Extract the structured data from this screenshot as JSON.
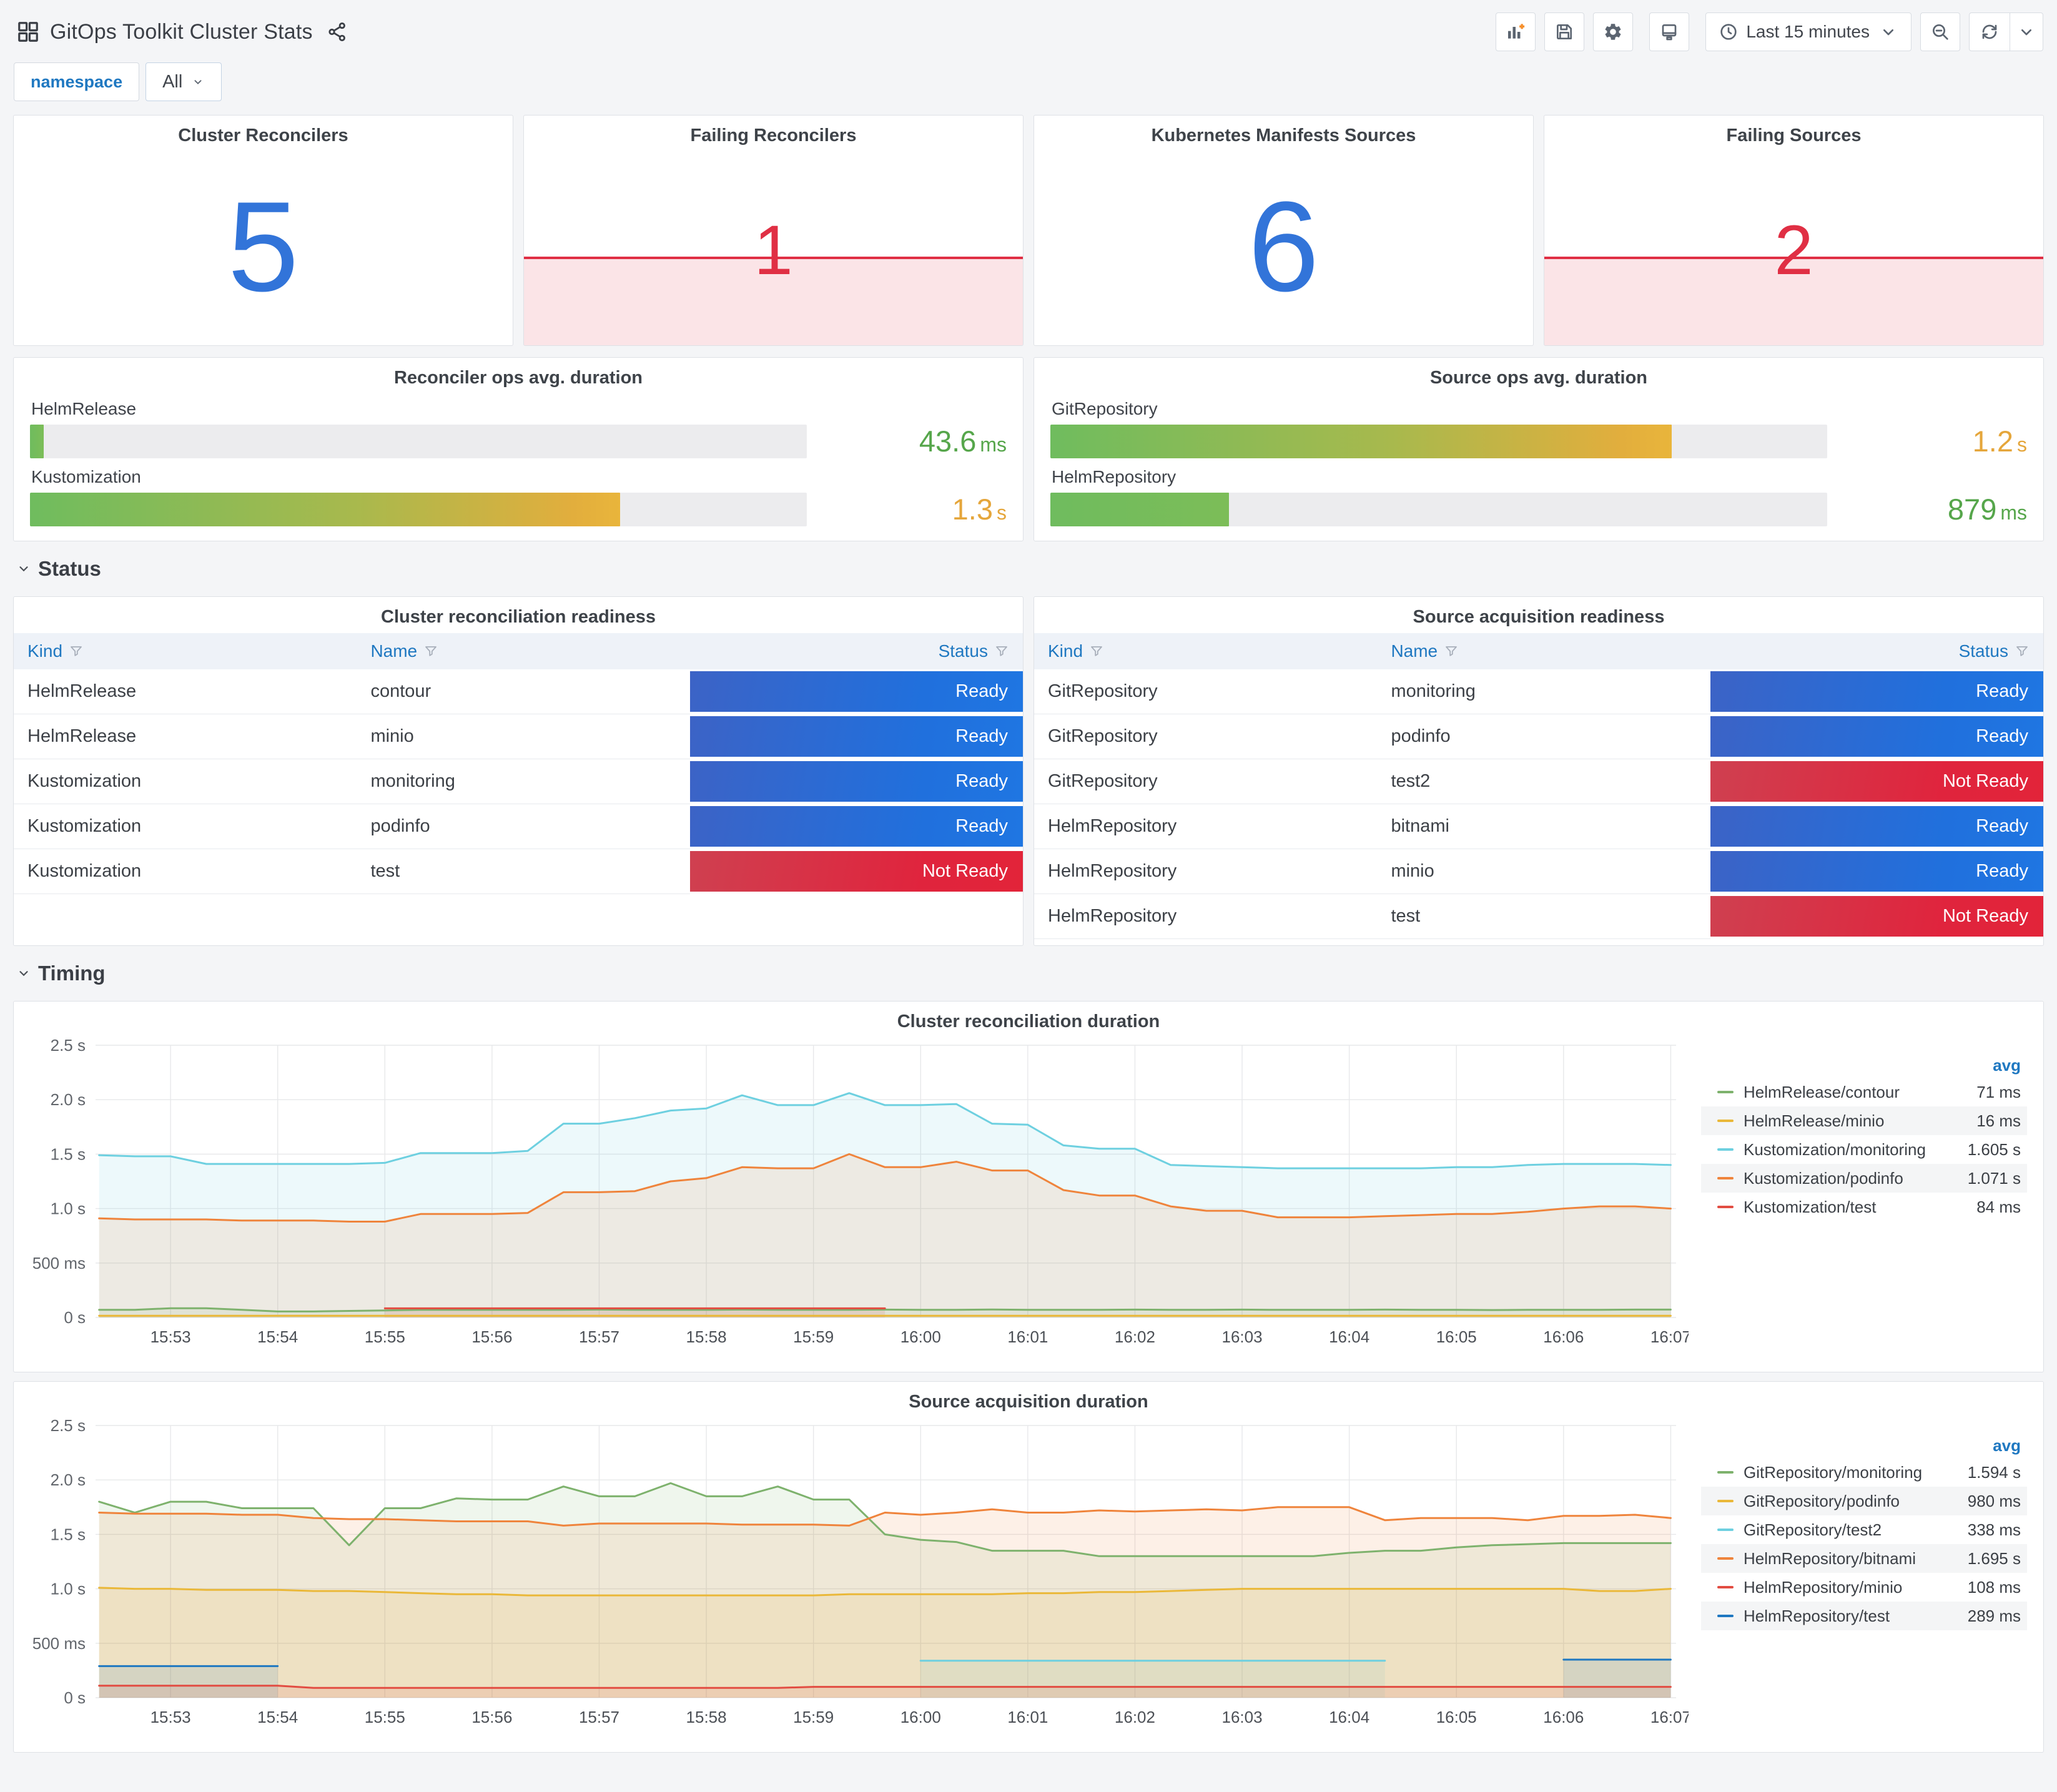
{
  "header": {
    "title": "GitOps Toolkit Cluster Stats"
  },
  "toolbar": {
    "time_range": "Last 15 minutes"
  },
  "filters": {
    "name": "namespace",
    "value": "All"
  },
  "sections": {
    "status": "Status",
    "timing": "Timing"
  },
  "stats": [
    {
      "title": "Cluster Reconcilers",
      "value": "5",
      "state": "ok"
    },
    {
      "title": "Failing Reconcilers",
      "value": "1",
      "state": "alert"
    },
    {
      "title": "Kubernetes Manifests Sources",
      "value": "6",
      "state": "ok"
    },
    {
      "title": "Failing Sources",
      "value": "2",
      "state": "alert"
    }
  ],
  "gauges": [
    {
      "title": "Reconciler ops avg. duration",
      "bars": [
        {
          "label": "HelmRelease",
          "num": "43.6",
          "unit": "ms",
          "pct": 1.8,
          "tone": "green"
        },
        {
          "label": "Kustomization",
          "num": "1.3",
          "unit": "s",
          "pct": 76,
          "tone": "orange"
        }
      ]
    },
    {
      "title": "Source ops avg. duration",
      "bars": [
        {
          "label": "GitRepository",
          "num": "1.2",
          "unit": "s",
          "pct": 80,
          "tone": "orange"
        },
        {
          "label": "HelmRepository",
          "num": "879",
          "unit": "ms",
          "pct": 23,
          "tone": "green"
        }
      ]
    }
  ],
  "tables": [
    {
      "title": "Cluster reconciliation readiness",
      "columns": [
        "Kind",
        "Name",
        "Status"
      ],
      "rows": [
        [
          "HelmRelease",
          "contour",
          "Ready"
        ],
        [
          "HelmRelease",
          "minio",
          "Ready"
        ],
        [
          "Kustomization",
          "monitoring",
          "Ready"
        ],
        [
          "Kustomization",
          "podinfo",
          "Ready"
        ],
        [
          "Kustomization",
          "test",
          "Not Ready"
        ]
      ]
    },
    {
      "title": "Source acquisition readiness",
      "columns": [
        "Kind",
        "Name",
        "Status"
      ],
      "rows": [
        [
          "GitRepository",
          "monitoring",
          "Ready"
        ],
        [
          "GitRepository",
          "podinfo",
          "Ready"
        ],
        [
          "GitRepository",
          "test2",
          "Not Ready"
        ],
        [
          "HelmRepository",
          "bitnami",
          "Ready"
        ],
        [
          "HelmRepository",
          "minio",
          "Ready"
        ],
        [
          "HelmRepository",
          "test",
          "Not Ready"
        ]
      ]
    }
  ],
  "chart_data": [
    {
      "type": "line",
      "title": "Cluster reconciliation duration",
      "legend_header": "avg",
      "ylim": [
        0,
        2.5
      ],
      "y_tick_values": [
        0,
        0.5,
        1.0,
        1.5,
        2.0,
        2.5
      ],
      "y_tick_labels": [
        "0 s",
        "500 ms",
        "1.0 s",
        "1.5 s",
        "2.0 s",
        "2.5 s"
      ],
      "x_domain": [
        52.3,
        67.05
      ],
      "x_start": 52.3333,
      "x_step": 0.33333,
      "x_tick_values": [
        53,
        54,
        55,
        56,
        57,
        58,
        59,
        60,
        61,
        62,
        63,
        64,
        65,
        66,
        67
      ],
      "x_tick_labels": [
        "15:53",
        "15:54",
        "15:55",
        "15:56",
        "15:57",
        "15:58",
        "15:59",
        "16:00",
        "16:01",
        "16:02",
        "16:03",
        "16:04",
        "16:05",
        "16:06",
        "16:07"
      ],
      "series": [
        {
          "name": "HelmRelease/contour",
          "avg": "71 ms",
          "color": "#7EB26D",
          "values": [
            0.07,
            0.07,
            0.085,
            0.085,
            0.07,
            0.055,
            0.055,
            0.06,
            0.065,
            0.07,
            0.07,
            0.07,
            0.07,
            0.07,
            0.072,
            0.07,
            0.07,
            0.07,
            0.072,
            0.07,
            0.07,
            0.07,
            0.072,
            0.07,
            0.07,
            0.073,
            0.07,
            0.07,
            0.07,
            0.072,
            0.07,
            0.07,
            0.072,
            0.07,
            0.07,
            0.07,
            0.072,
            0.07,
            0.07,
            0.068,
            0.07,
            0.07,
            0.07,
            0.072,
            0.072
          ]
        },
        {
          "name": "HelmRelease/minio",
          "avg": "16 ms",
          "color": "#EAB839",
          "values": [
            0.016,
            0.016,
            0.016,
            0.016,
            0.016,
            0.016,
            0.016,
            0.016,
            0.016,
            0.016,
            0.016,
            0.016,
            0.016,
            0.016,
            0.016,
            0.016,
            0.016,
            0.016,
            0.016,
            0.016,
            0.016,
            0.016,
            0.016,
            0.016,
            0.016,
            0.016,
            0.016,
            0.016,
            0.016,
            0.016,
            0.016,
            0.016,
            0.016,
            0.016,
            0.016,
            0.016,
            0.016,
            0.016,
            0.016,
            0.016,
            0.016,
            0.016,
            0.016,
            0.016,
            0.016
          ]
        },
        {
          "name": "Kustomization/monitoring",
          "avg": "1.605 s",
          "color": "#6ED0E0",
          "values": [
            1.49,
            1.48,
            1.48,
            1.41,
            1.41,
            1.41,
            1.41,
            1.41,
            1.42,
            1.51,
            1.51,
            1.51,
            1.53,
            1.78,
            1.78,
            1.83,
            1.9,
            1.92,
            2.04,
            1.95,
            1.95,
            2.06,
            1.95,
            1.95,
            1.96,
            1.78,
            1.77,
            1.58,
            1.55,
            1.55,
            1.4,
            1.39,
            1.38,
            1.37,
            1.37,
            1.37,
            1.37,
            1.37,
            1.38,
            1.38,
            1.4,
            1.41,
            1.41,
            1.41,
            1.4
          ]
        },
        {
          "name": "Kustomization/podinfo",
          "avg": "1.071 s",
          "color": "#EF843C",
          "values": [
            0.91,
            0.9,
            0.9,
            0.9,
            0.89,
            0.89,
            0.89,
            0.88,
            0.88,
            0.95,
            0.95,
            0.95,
            0.96,
            1.15,
            1.15,
            1.16,
            1.25,
            1.28,
            1.38,
            1.37,
            1.37,
            1.5,
            1.38,
            1.38,
            1.43,
            1.35,
            1.35,
            1.17,
            1.12,
            1.12,
            1.02,
            0.98,
            0.98,
            0.92,
            0.92,
            0.92,
            0.93,
            0.94,
            0.95,
            0.95,
            0.97,
            1.0,
            1.02,
            1.02,
            1.0
          ]
        },
        {
          "name": "Kustomization/test",
          "avg": "84 ms",
          "color": "#E24D42",
          "values": [
            null,
            null,
            null,
            null,
            null,
            null,
            null,
            null,
            0.084,
            0.084,
            0.084,
            0.084,
            0.084,
            0.084,
            0.084,
            0.084,
            0.084,
            0.084,
            0.084,
            0.084,
            0.084,
            0.084,
            0.084,
            null,
            null,
            null,
            null,
            null,
            null,
            null,
            null,
            null,
            null,
            null,
            null,
            null,
            null,
            null,
            null,
            null,
            null,
            null,
            null,
            null,
            null
          ]
        }
      ]
    },
    {
      "type": "line",
      "title": "Source acquisition duration",
      "legend_header": "avg",
      "ylim": [
        0,
        2.5
      ],
      "y_tick_values": [
        0,
        0.5,
        1.0,
        1.5,
        2.0,
        2.5
      ],
      "y_tick_labels": [
        "0 s",
        "500 ms",
        "1.0 s",
        "1.5 s",
        "2.0 s",
        "2.5 s"
      ],
      "x_domain": [
        52.3,
        67.05
      ],
      "x_start": 52.3333,
      "x_step": 0.33333,
      "x_tick_values": [
        53,
        54,
        55,
        56,
        57,
        58,
        59,
        60,
        61,
        62,
        63,
        64,
        65,
        66,
        67
      ],
      "x_tick_labels": [
        "15:53",
        "15:54",
        "15:55",
        "15:56",
        "15:57",
        "15:58",
        "15:59",
        "16:00",
        "16:01",
        "16:02",
        "16:03",
        "16:04",
        "16:05",
        "16:06",
        "16:07"
      ],
      "series": [
        {
          "name": "GitRepository/monitoring",
          "avg": "1.594 s",
          "color": "#7EB26D",
          "values": [
            1.8,
            1.7,
            1.8,
            1.8,
            1.74,
            1.74,
            1.74,
            1.4,
            1.74,
            1.74,
            1.83,
            1.82,
            1.82,
            1.94,
            1.85,
            1.85,
            1.97,
            1.85,
            1.85,
            1.94,
            1.82,
            1.82,
            1.5,
            1.45,
            1.43,
            1.35,
            1.35,
            1.35,
            1.3,
            1.3,
            1.3,
            1.3,
            1.3,
            1.3,
            1.3,
            1.33,
            1.35,
            1.35,
            1.38,
            1.4,
            1.41,
            1.42,
            1.42,
            1.42,
            1.42
          ]
        },
        {
          "name": "GitRepository/podinfo",
          "avg": "980 ms",
          "color": "#EAB839",
          "values": [
            1.01,
            1.0,
            1.0,
            0.99,
            0.99,
            0.99,
            0.98,
            0.98,
            0.97,
            0.96,
            0.95,
            0.95,
            0.94,
            0.94,
            0.94,
            0.94,
            0.94,
            0.94,
            0.94,
            0.94,
            0.94,
            0.95,
            0.95,
            0.95,
            0.95,
            0.95,
            0.96,
            0.96,
            0.97,
            0.97,
            0.98,
            0.99,
            1.0,
            1.0,
            1.0,
            1.0,
            1.0,
            1.0,
            1.0,
            1.0,
            1.0,
            1.0,
            0.98,
            0.98,
            1.0
          ]
        },
        {
          "name": "GitRepository/test2",
          "avg": "338 ms",
          "color": "#6ED0E0",
          "values": [
            null,
            null,
            null,
            null,
            null,
            null,
            null,
            null,
            null,
            null,
            null,
            null,
            null,
            null,
            null,
            null,
            null,
            null,
            null,
            null,
            null,
            null,
            null,
            0.34,
            0.34,
            0.34,
            0.34,
            0.34,
            0.34,
            0.34,
            0.34,
            0.34,
            0.34,
            0.34,
            0.34,
            0.34,
            0.34,
            null,
            null,
            null,
            null,
            null,
            null,
            null,
            null
          ]
        },
        {
          "name": "HelmRepository/bitnami",
          "avg": "1.695 s",
          "color": "#EF843C",
          "values": [
            1.7,
            1.69,
            1.69,
            1.69,
            1.68,
            1.68,
            1.65,
            1.64,
            1.64,
            1.63,
            1.62,
            1.62,
            1.62,
            1.58,
            1.6,
            1.6,
            1.6,
            1.6,
            1.59,
            1.59,
            1.59,
            1.58,
            1.7,
            1.68,
            1.7,
            1.73,
            1.7,
            1.7,
            1.72,
            1.71,
            1.72,
            1.73,
            1.72,
            1.75,
            1.75,
            1.75,
            1.63,
            1.65,
            1.65,
            1.65,
            1.63,
            1.67,
            1.67,
            1.68,
            1.65
          ]
        },
        {
          "name": "HelmRepository/minio",
          "avg": "108 ms",
          "color": "#E24D42",
          "values": [
            0.11,
            0.11,
            0.11,
            0.11,
            0.11,
            0.11,
            0.09,
            0.09,
            0.09,
            0.09,
            0.09,
            0.09,
            0.09,
            0.09,
            0.09,
            0.09,
            0.09,
            0.09,
            0.09,
            0.09,
            0.1,
            0.1,
            0.1,
            0.1,
            0.1,
            0.1,
            0.1,
            0.1,
            0.1,
            0.1,
            0.1,
            0.1,
            0.1,
            0.1,
            0.1,
            0.1,
            0.1,
            0.1,
            0.1,
            0.1,
            0.1,
            0.1,
            0.1,
            0.1,
            0.1
          ]
        },
        {
          "name": "HelmRepository/test",
          "avg": "289 ms",
          "color": "#1F78C1",
          "values": [
            0.29,
            0.29,
            0.29,
            0.29,
            0.29,
            0.29,
            null,
            null,
            null,
            null,
            null,
            null,
            null,
            null,
            null,
            null,
            null,
            null,
            null,
            null,
            null,
            null,
            null,
            null,
            null,
            null,
            null,
            null,
            null,
            null,
            null,
            null,
            null,
            null,
            null,
            null,
            null,
            null,
            null,
            null,
            null,
            0.35,
            0.35,
            0.35,
            0.35
          ]
        }
      ]
    }
  ]
}
